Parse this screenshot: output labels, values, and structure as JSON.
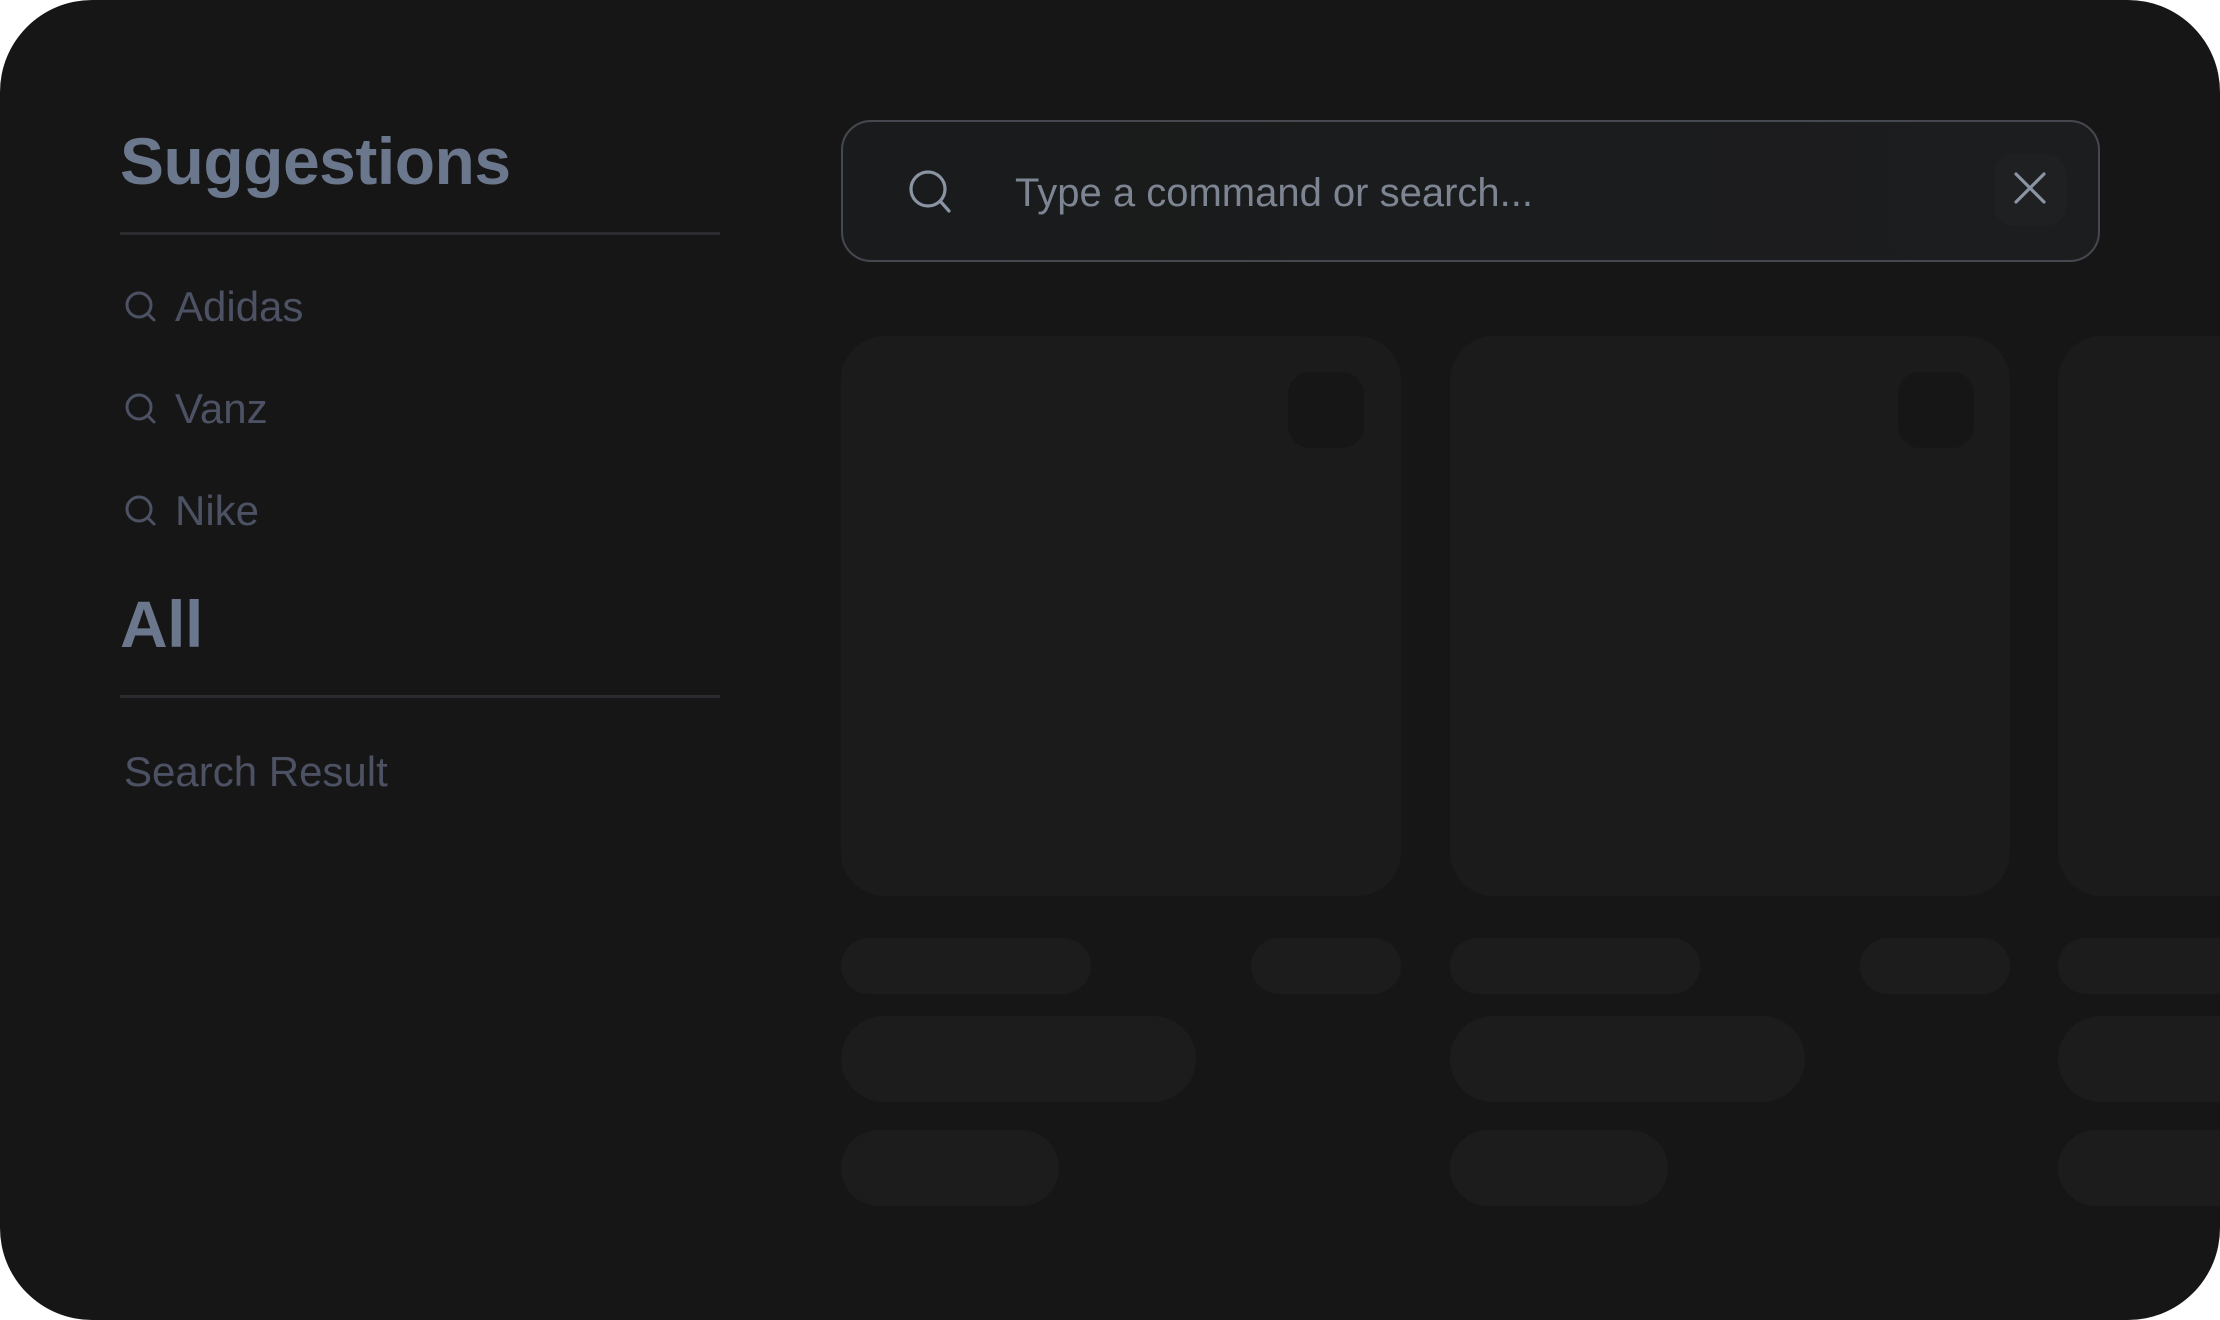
{
  "sidebar": {
    "suggestions_title": "Suggestions",
    "suggestions": [
      {
        "label": "Adidas",
        "icon": "search-icon"
      },
      {
        "label": "Vanz",
        "icon": "search-icon"
      },
      {
        "label": "Nike",
        "icon": "search-icon"
      }
    ],
    "all_title": "All",
    "search_result_label": "Search Result"
  },
  "search": {
    "placeholder": "Type a command or search...",
    "value": "",
    "search_icon": "search-icon",
    "clear_icon": "close-icon"
  },
  "results": {
    "state": "loading",
    "cards_visible": 3
  },
  "colors": {
    "background": "#161616",
    "card": "#1b1b1b",
    "heading": "#6b778c",
    "muted_text": "#4c5263",
    "divider": "#2a2b2e"
  }
}
